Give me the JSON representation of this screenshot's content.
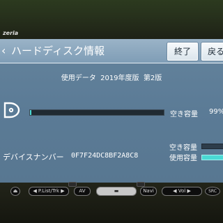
{
  "device": {
    "brand": "zeria"
  },
  "header": {
    "title": "ハードディスク情報",
    "buttons": {
      "end_label": "終了",
      "back_label": "戻る"
    }
  },
  "info": {
    "usage_data_line": "使用データ  2019年度版  第2版"
  },
  "disk": {
    "free_label": "空き容量",
    "free_percent": "99%",
    "used_fraction": 0.01
  },
  "device_info": {
    "label": "デバイスナンバー",
    "value": "0F7F24DC8BF2A8C8"
  },
  "legend": {
    "free_label": "空き容量",
    "used_label": "使用容量",
    "free_color": "#2d3c4a",
    "used_color": "#4ad9d4"
  },
  "hardware_buttons": {
    "plist": "◀ P.List/Trk ▶",
    "av": "AV",
    "navi": "Navi",
    "vol": "◀ Vol ▶",
    "src": "SRC"
  }
}
